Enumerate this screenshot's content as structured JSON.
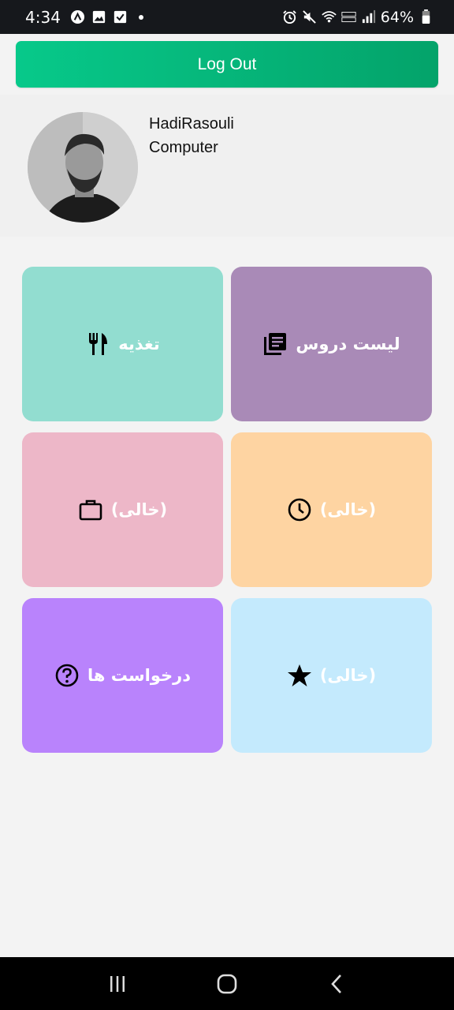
{
  "status_bar": {
    "time": "4:34",
    "battery": "64%"
  },
  "logout": {
    "label": "Log Out"
  },
  "profile": {
    "name": "HadiRasouli",
    "department": "Computer"
  },
  "tiles": [
    {
      "label": "لیست دروس",
      "icon": "book-icon",
      "color": "#a98ab7"
    },
    {
      "label": "تغذیه",
      "icon": "fork-knife-icon",
      "color": "#92ddd0"
    },
    {
      "label": "(خالی)",
      "icon": "clock-icon",
      "color": "#fed4a2"
    },
    {
      "label": "(خالی)",
      "icon": "briefcase-icon",
      "color": "#edb7c8"
    },
    {
      "label": "(خالی)",
      "icon": "star-icon",
      "color": "#c4eafd"
    },
    {
      "label": "درخواست ها",
      "icon": "question-icon",
      "color": "#b983fc"
    }
  ],
  "colors": {
    "logout_start": "#07c98a",
    "logout_end": "#04a36a",
    "background": "#f3f3f3"
  }
}
